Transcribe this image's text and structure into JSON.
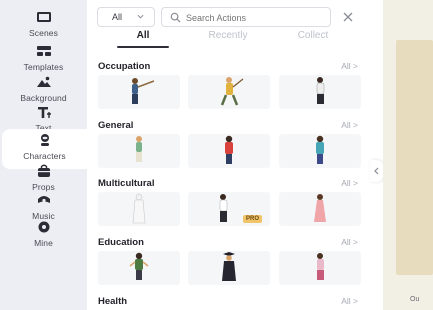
{
  "sidebar": {
    "items": [
      {
        "label": "Scenes",
        "icon": "film-icon"
      },
      {
        "label": "Templates",
        "icon": "template-icon"
      },
      {
        "label": "Background",
        "icon": "image-icon"
      },
      {
        "label": "Text",
        "icon": "text-icon"
      },
      {
        "label": "Characters",
        "icon": "character-icon",
        "active": true
      },
      {
        "label": "Props",
        "icon": "bag-icon"
      },
      {
        "label": "Music",
        "icon": "music-icon"
      },
      {
        "label": "Mine",
        "icon": "folder-icon"
      }
    ]
  },
  "search": {
    "category": "All",
    "placeholder": "Search Actions"
  },
  "tabs": [
    "All",
    "Recently",
    "Collect"
  ],
  "sections": [
    {
      "title": "Occupation",
      "all_label": "All >"
    },
    {
      "title": "General",
      "all_label": "All >"
    },
    {
      "title": "Multicultural",
      "all_label": "All >"
    },
    {
      "title": "Education",
      "all_label": "All >"
    },
    {
      "title": "Health",
      "all_label": "All >"
    }
  ],
  "badges": {
    "pro": "PRO"
  },
  "canvas": {
    "label": "Ou"
  },
  "colors": {
    "accent": "#2f2f3a",
    "rail_bg": "#eceef3",
    "pro_badge": "#f2c46a"
  }
}
